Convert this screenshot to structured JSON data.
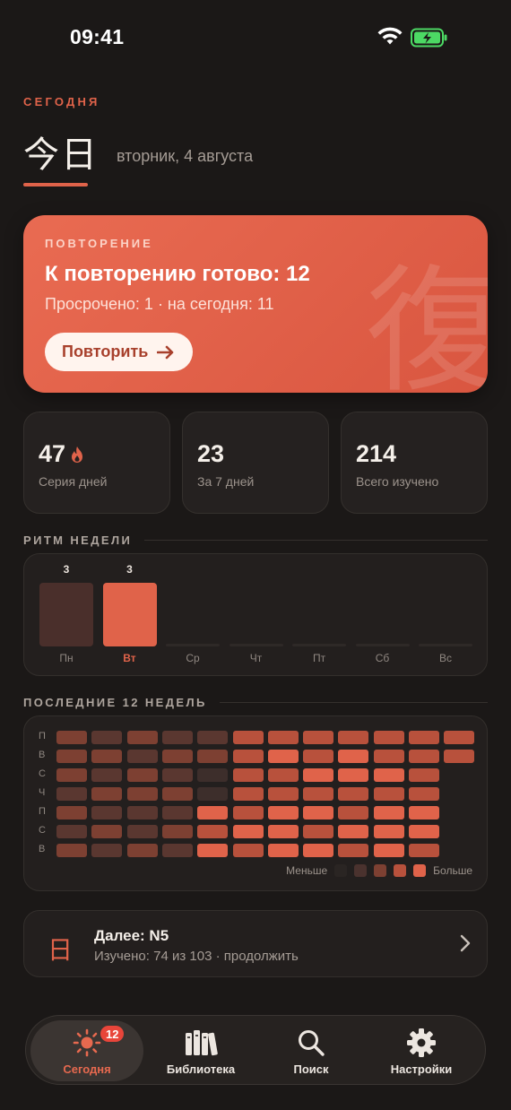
{
  "status_bar": {
    "time": "09:41"
  },
  "header": {
    "eyebrow": "СЕГОДНЯ",
    "kanji_title": "今日",
    "date": "вторник, 4 августа"
  },
  "review_card": {
    "eyebrow": "ПОВТОРЕНИЕ",
    "title": "К повторению готово: 12",
    "subtitle": "Просрочено: 1 · на сегодня: 11",
    "button_label": "Повторить",
    "background_kanji": "復"
  },
  "stats": [
    {
      "value": "47",
      "label": "Серия дней",
      "has_flame": true
    },
    {
      "value": "23",
      "label": "За 7 дней",
      "has_flame": false
    },
    {
      "value": "214",
      "label": "Всего изучено",
      "has_flame": false
    }
  ],
  "week_rhythm": {
    "section_label": "РИТМ НЕДЕЛИ",
    "days": [
      {
        "day": "Пн",
        "value": 3,
        "value_label": "3",
        "today": false
      },
      {
        "day": "Вт",
        "value": 3,
        "value_label": "3",
        "today": true
      },
      {
        "day": "Ср",
        "value": 0,
        "value_label": "",
        "today": false
      },
      {
        "day": "Чт",
        "value": 0,
        "value_label": "",
        "today": false
      },
      {
        "day": "Пт",
        "value": 0,
        "value_label": "",
        "today": false
      },
      {
        "day": "Сб",
        "value": 0,
        "value_label": "",
        "today": false
      },
      {
        "day": "Вс",
        "value": 0,
        "value_label": "",
        "today": false
      }
    ]
  },
  "heatmap": {
    "section_label": "ПОСЛЕДНИЕ 12 НЕДЕЛЬ",
    "row_labels": [
      "П",
      "В",
      "С",
      "Ч",
      "П",
      "С",
      "В"
    ],
    "levels": [
      [
        3,
        2,
        3,
        2,
        2,
        4,
        4,
        4,
        4,
        4,
        4,
        4
      ],
      [
        3,
        3,
        2,
        3,
        3,
        4,
        5,
        4,
        5,
        4,
        4,
        4
      ],
      [
        3,
        2,
        3,
        2,
        1,
        4,
        4,
        5,
        5,
        5,
        4,
        -1
      ],
      [
        2,
        3,
        3,
        3,
        1,
        4,
        4,
        4,
        4,
        4,
        4,
        -1
      ],
      [
        3,
        2,
        2,
        2,
        5,
        4,
        5,
        5,
        4,
        5,
        5,
        -1
      ],
      [
        2,
        3,
        2,
        3,
        4,
        5,
        5,
        4,
        5,
        5,
        5,
        -1
      ],
      [
        3,
        2,
        3,
        2,
        5,
        4,
        5,
        5,
        4,
        5,
        4,
        -1
      ]
    ],
    "legend_less": "Меньше",
    "legend_more": "Больше",
    "colors": [
      "#2a2523",
      "#3d2e2b",
      "#5a3730",
      "#7d4032",
      "#b8513c",
      "#e0634a"
    ]
  },
  "next_card": {
    "kanji": "日",
    "title": "Далее: N5",
    "subtitle": "Изучено: 74 из 103 · продолжить"
  },
  "tab_bar": {
    "tabs": [
      {
        "label": "Сегодня",
        "icon": "sun-icon",
        "active": true,
        "badge": "12"
      },
      {
        "label": "Библиотека",
        "icon": "books-icon",
        "active": false
      },
      {
        "label": "Поиск",
        "icon": "search-icon",
        "active": false
      },
      {
        "label": "Настройки",
        "icon": "gear-icon",
        "active": false
      }
    ]
  },
  "theme": {
    "accent": "#e0634a",
    "background": "#1b1817"
  }
}
